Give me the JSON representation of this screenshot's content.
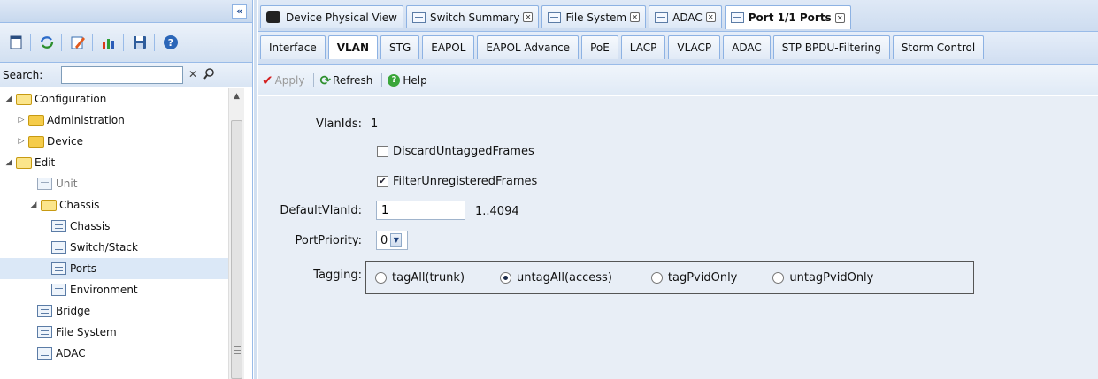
{
  "left": {
    "collapse_label": "«",
    "toolbar_icons": [
      "window-icon",
      "refresh-icon",
      "edit-icon",
      "chart-icon",
      "save-icon",
      "help-icon"
    ],
    "search_label": "Search:",
    "search_value": "",
    "tree": [
      {
        "label": "Configuration",
        "arrow": "◢",
        "type": "folder-open"
      },
      {
        "label": "Administration",
        "arrow": "▷",
        "type": "folder"
      },
      {
        "label": "Device",
        "arrow": "▷",
        "type": "folder"
      },
      {
        "label": "Edit",
        "arrow": "◢",
        "type": "folder-open"
      },
      {
        "label": "Unit",
        "arrow": "",
        "type": "leaf-dim"
      },
      {
        "label": "Chassis",
        "arrow": "◢",
        "type": "folder-open"
      },
      {
        "label": "Chassis",
        "arrow": "",
        "type": "leaf"
      },
      {
        "label": "Switch/Stack",
        "arrow": "",
        "type": "leaf"
      },
      {
        "label": "Ports",
        "arrow": "",
        "type": "leaf",
        "selected": true
      },
      {
        "label": "Environment",
        "arrow": "",
        "type": "leaf"
      },
      {
        "label": "Bridge",
        "arrow": "",
        "type": "leaf"
      },
      {
        "label": "File System",
        "arrow": "",
        "type": "leaf"
      },
      {
        "label": "ADAC",
        "arrow": "",
        "type": "leaf"
      }
    ]
  },
  "doc_tabs": [
    {
      "label": "Device Physical View",
      "closable": false,
      "icon": "device-icon"
    },
    {
      "label": "Switch Summary",
      "closable": true,
      "icon": "page-icon"
    },
    {
      "label": "File System",
      "closable": true,
      "icon": "page-icon"
    },
    {
      "label": "ADAC",
      "closable": true,
      "icon": "page-icon"
    },
    {
      "label": "Port 1/1 Ports",
      "closable": true,
      "icon": "page-icon",
      "active": true
    }
  ],
  "sub_tabs": [
    {
      "label": "Interface"
    },
    {
      "label": "VLAN",
      "active": true
    },
    {
      "label": "STG"
    },
    {
      "label": "EAPOL"
    },
    {
      "label": "EAPOL Advance"
    },
    {
      "label": "PoE"
    },
    {
      "label": "LACP"
    },
    {
      "label": "VLACP"
    },
    {
      "label": "ADAC"
    },
    {
      "label": "STP BPDU-Filtering"
    },
    {
      "label": "Storm Control"
    }
  ],
  "actions": {
    "apply": "Apply",
    "refresh": "Refresh",
    "help": "Help"
  },
  "form": {
    "vlanids_label": "VlanIds:",
    "vlanids_value": "1",
    "discard_label": "DiscardUntaggedFrames",
    "discard_checked": false,
    "filter_label": "FilterUnregisteredFrames",
    "filter_checked": true,
    "default_vlan_label": "DefaultVlanId:",
    "default_vlan_value": "1",
    "default_vlan_range": "1..4094",
    "priority_label": "PortPriority:",
    "priority_value": "0",
    "tagging_label": "Tagging:",
    "tagging_options": [
      {
        "label": "tagAll(trunk)",
        "selected": false
      },
      {
        "label": "untagAll(access)",
        "selected": true
      },
      {
        "label": "tagPvidOnly",
        "selected": false
      },
      {
        "label": "untagPvidOnly",
        "selected": false
      }
    ]
  }
}
